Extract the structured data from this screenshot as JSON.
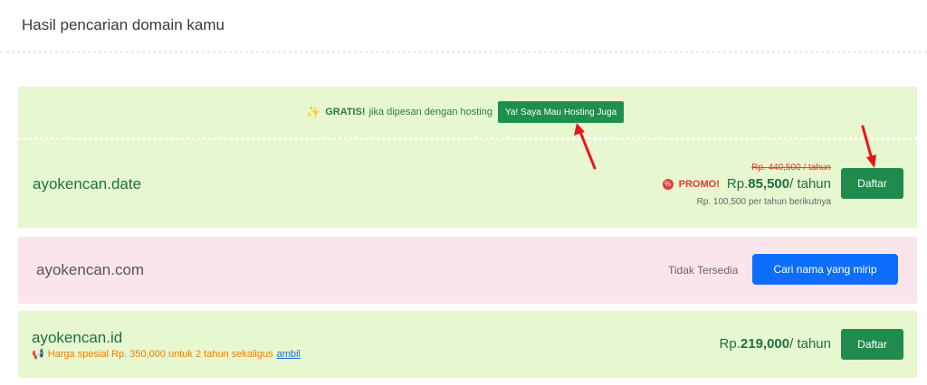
{
  "page": {
    "title": "Hasil pencarian domain kamu"
  },
  "promo": {
    "sparkle_icon": "sparkle-icon",
    "gratis": "GRATIS!",
    "description": "jika dipesan dengan hosting",
    "hosting_button": "Ya! Saya Mau Hosting Juga"
  },
  "results": [
    {
      "domain": "ayokencan.date",
      "status": "available",
      "old_price": "Rp. 440,500 / tahun",
      "promo_label": "PROMO!",
      "price_prefix": "Rp.",
      "price_amount": "85,500",
      "price_suffix": "/ tahun",
      "renew_note": "Rp. 100,500 per tahun berikutnya",
      "button": "Daftar"
    },
    {
      "domain": "ayokencan.com",
      "status": "unavailable",
      "status_text": "Tidak Tersedia",
      "button": "Cari nama yang mirip"
    },
    {
      "domain": "ayokencan.id",
      "status": "available",
      "special_note": "Harga spesial Rp. 350,000 untuk 2 tahun sekaligus",
      "special_link": "ambil",
      "price_prefix": "Rp.",
      "price_amount": "219,000",
      "price_suffix": "/ tahun",
      "button": "Daftar"
    }
  ],
  "colors": {
    "available_bg": "#e7f7d0",
    "unavailable_bg": "#fae6ea",
    "primary_green": "#1f8b4d",
    "primary_blue": "#0d6efd",
    "promo_red": "#e53935",
    "annotation_arrow": "#e8161b"
  }
}
